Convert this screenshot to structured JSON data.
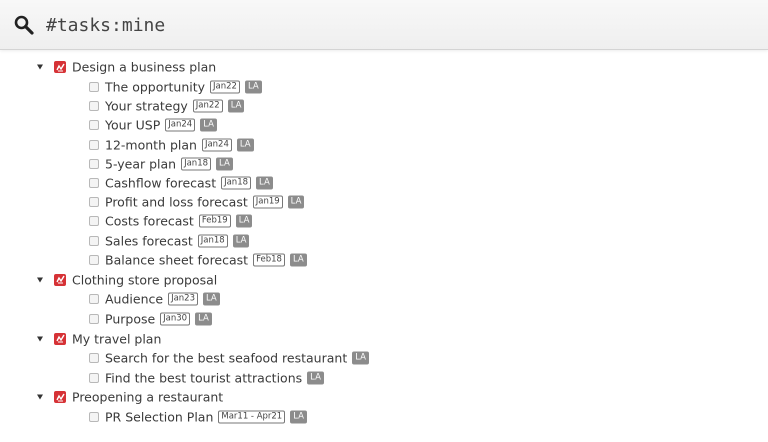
{
  "search": {
    "query": "#tasks:mine"
  },
  "colors": {
    "project_icon": "#d63236",
    "user_tag": "#8c8c8c"
  },
  "projects": [
    {
      "title": "Design a business plan",
      "tasks": [
        {
          "title": "The opportunity",
          "date": "Jan22",
          "assignee": "LA"
        },
        {
          "title": "Your strategy",
          "date": "Jan22",
          "assignee": "LA"
        },
        {
          "title": "Your USP",
          "date": "Jan24",
          "assignee": "LA"
        },
        {
          "title": "12-month plan",
          "date": "Jan24",
          "assignee": "LA"
        },
        {
          "title": "5-year plan",
          "date": "Jan18",
          "assignee": "LA"
        },
        {
          "title": "Cashflow forecast",
          "date": "Jan18",
          "assignee": "LA"
        },
        {
          "title": "Profit and loss forecast",
          "date": "Jan19",
          "assignee": "LA"
        },
        {
          "title": "Costs forecast",
          "date": "Feb19",
          "assignee": "LA"
        },
        {
          "title": "Sales forecast",
          "date": "Jan18",
          "assignee": "LA"
        },
        {
          "title": "Balance sheet forecast",
          "date": "Feb18",
          "assignee": "LA"
        }
      ]
    },
    {
      "title": "Clothing store proposal",
      "tasks": [
        {
          "title": "Audience",
          "date": "Jan23",
          "assignee": "LA"
        },
        {
          "title": "Purpose",
          "date": "Jan30",
          "assignee": "LA"
        }
      ]
    },
    {
      "title": "My travel plan",
      "tasks": [
        {
          "title": "Search for the best seafood restaurant",
          "date": "",
          "assignee": "LA"
        },
        {
          "title": "Find the best tourist attractions",
          "date": "",
          "assignee": "LA"
        }
      ]
    },
    {
      "title": "Preopening a restaurant",
      "tasks": [
        {
          "title": "PR Selection Plan",
          "date": "Mar11  -  Apr21",
          "assignee": "LA"
        }
      ]
    }
  ]
}
